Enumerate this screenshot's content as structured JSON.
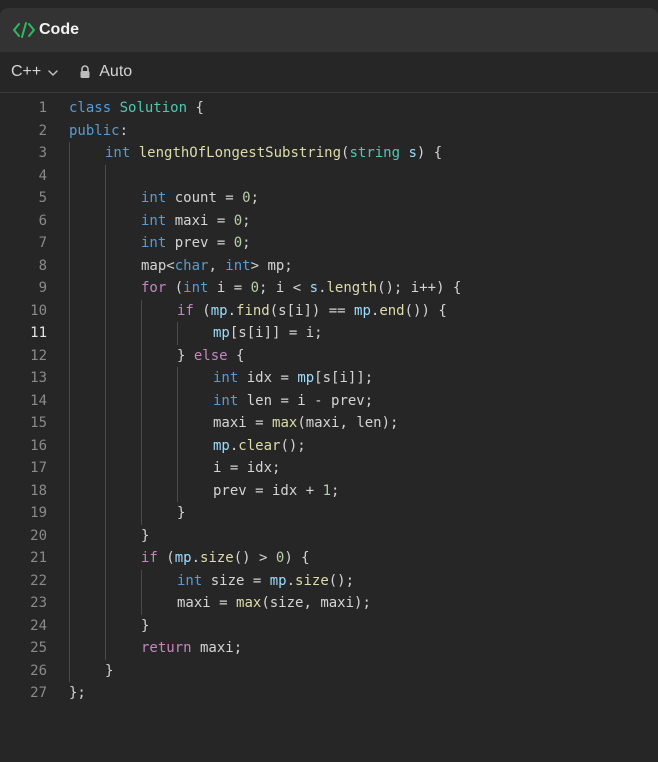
{
  "header": {
    "title": "Code"
  },
  "toolbar": {
    "language": "C++",
    "mode": "Auto"
  },
  "icons": {
    "code": "code-brackets-icon",
    "chevron": "chevron-down-icon",
    "lock": "lock-icon"
  },
  "colors": {
    "accent": "#2cbb5d",
    "keyword": "#569cd6",
    "type": "#4ec9b0",
    "function": "#dcdcaa",
    "number": "#b5cea8",
    "variable": "#9cdcfe"
  },
  "editor": {
    "active_line": 11,
    "lines": [
      {
        "n": 1,
        "indent": 0,
        "tokens": [
          [
            "kw",
            "class"
          ],
          [
            "pl",
            " "
          ],
          [
            "ty",
            "Solution"
          ],
          [
            "pl",
            " {"
          ]
        ]
      },
      {
        "n": 2,
        "indent": 0,
        "tokens": [
          [
            "kw",
            "public"
          ],
          [
            "pl",
            ":"
          ]
        ]
      },
      {
        "n": 3,
        "indent": 1,
        "tokens": [
          [
            "kw",
            "int"
          ],
          [
            "pl",
            " "
          ],
          [
            "fn",
            "lengthOfLongestSubstring"
          ],
          [
            "pl",
            "("
          ],
          [
            "ty",
            "string"
          ],
          [
            "pl",
            " "
          ],
          [
            "vr",
            "s"
          ],
          [
            "pl",
            ") {"
          ]
        ]
      },
      {
        "n": 4,
        "indent": 0,
        "tokens": []
      },
      {
        "n": 5,
        "indent": 2,
        "tokens": [
          [
            "kw",
            "int"
          ],
          [
            "pl",
            " count = "
          ],
          [
            "nm",
            "0"
          ],
          [
            "pl",
            ";"
          ]
        ]
      },
      {
        "n": 6,
        "indent": 2,
        "tokens": [
          [
            "kw",
            "int"
          ],
          [
            "pl",
            " maxi = "
          ],
          [
            "nm",
            "0"
          ],
          [
            "pl",
            ";"
          ]
        ]
      },
      {
        "n": 7,
        "indent": 2,
        "tokens": [
          [
            "kw",
            "int"
          ],
          [
            "pl",
            " prev = "
          ],
          [
            "nm",
            "0"
          ],
          [
            "pl",
            ";"
          ]
        ]
      },
      {
        "n": 8,
        "indent": 2,
        "tokens": [
          [
            "pl",
            "map<"
          ],
          [
            "kw",
            "char"
          ],
          [
            "pl",
            ", "
          ],
          [
            "kw",
            "int"
          ],
          [
            "pl",
            "> mp;"
          ]
        ]
      },
      {
        "n": 9,
        "indent": 2,
        "tokens": [
          [
            "ct",
            "for"
          ],
          [
            "pl",
            " ("
          ],
          [
            "kw",
            "int"
          ],
          [
            "pl",
            " i = "
          ],
          [
            "nm",
            "0"
          ],
          [
            "pl",
            "; i < "
          ],
          [
            "vr",
            "s"
          ],
          [
            "pl",
            "."
          ],
          [
            "fn",
            "length"
          ],
          [
            "pl",
            "(); i++) {"
          ]
        ]
      },
      {
        "n": 10,
        "indent": 3,
        "tokens": [
          [
            "ct",
            "if"
          ],
          [
            "pl",
            " ("
          ],
          [
            "vr",
            "mp"
          ],
          [
            "pl",
            "."
          ],
          [
            "fn",
            "find"
          ],
          [
            "pl",
            "(s[i]) == "
          ],
          [
            "vr",
            "mp"
          ],
          [
            "pl",
            "."
          ],
          [
            "fn",
            "end"
          ],
          [
            "pl",
            "()) {"
          ]
        ]
      },
      {
        "n": 11,
        "indent": 4,
        "tokens": [
          [
            "vr",
            "mp"
          ],
          [
            "pl",
            "[s[i]] = i;"
          ]
        ]
      },
      {
        "n": 12,
        "indent": 3,
        "tokens": [
          [
            "pl",
            "} "
          ],
          [
            "ct",
            "else"
          ],
          [
            "pl",
            " {"
          ]
        ]
      },
      {
        "n": 13,
        "indent": 4,
        "tokens": [
          [
            "kw",
            "int"
          ],
          [
            "pl",
            " idx = "
          ],
          [
            "vr",
            "mp"
          ],
          [
            "pl",
            "[s[i]];"
          ]
        ]
      },
      {
        "n": 14,
        "indent": 4,
        "tokens": [
          [
            "kw",
            "int"
          ],
          [
            "pl",
            " len = i - prev;"
          ]
        ]
      },
      {
        "n": 15,
        "indent": 4,
        "tokens": [
          [
            "pl",
            "maxi = "
          ],
          [
            "fn",
            "max"
          ],
          [
            "pl",
            "(maxi, len);"
          ]
        ]
      },
      {
        "n": 16,
        "indent": 4,
        "tokens": [
          [
            "vr",
            "mp"
          ],
          [
            "pl",
            "."
          ],
          [
            "fn",
            "clear"
          ],
          [
            "pl",
            "();"
          ]
        ]
      },
      {
        "n": 17,
        "indent": 4,
        "tokens": [
          [
            "pl",
            "i = idx;"
          ]
        ]
      },
      {
        "n": 18,
        "indent": 4,
        "tokens": [
          [
            "pl",
            "prev = idx + "
          ],
          [
            "nm",
            "1"
          ],
          [
            "pl",
            ";"
          ]
        ]
      },
      {
        "n": 19,
        "indent": 3,
        "tokens": [
          [
            "pl",
            "}"
          ]
        ]
      },
      {
        "n": 20,
        "indent": 2,
        "tokens": [
          [
            "pl",
            "}"
          ]
        ]
      },
      {
        "n": 21,
        "indent": 2,
        "tokens": [
          [
            "ct",
            "if"
          ],
          [
            "pl",
            " ("
          ],
          [
            "vr",
            "mp"
          ],
          [
            "pl",
            "."
          ],
          [
            "fn",
            "size"
          ],
          [
            "pl",
            "() > "
          ],
          [
            "nm",
            "0"
          ],
          [
            "pl",
            ") {"
          ]
        ]
      },
      {
        "n": 22,
        "indent": 3,
        "tokens": [
          [
            "kw",
            "int"
          ],
          [
            "pl",
            " size = "
          ],
          [
            "vr",
            "mp"
          ],
          [
            "pl",
            "."
          ],
          [
            "fn",
            "size"
          ],
          [
            "pl",
            "();"
          ]
        ]
      },
      {
        "n": 23,
        "indent": 3,
        "tokens": [
          [
            "pl",
            "maxi = "
          ],
          [
            "fn",
            "max"
          ],
          [
            "pl",
            "(size, maxi);"
          ]
        ]
      },
      {
        "n": 24,
        "indent": 2,
        "tokens": [
          [
            "pl",
            "}"
          ]
        ]
      },
      {
        "n": 25,
        "indent": 2,
        "tokens": [
          [
            "ct",
            "return"
          ],
          [
            "pl",
            " maxi;"
          ]
        ]
      },
      {
        "n": 26,
        "indent": 1,
        "tokens": [
          [
            "pl",
            "}"
          ]
        ]
      },
      {
        "n": 27,
        "indent": 0,
        "tokens": [
          [
            "pl",
            "};"
          ]
        ]
      }
    ]
  }
}
